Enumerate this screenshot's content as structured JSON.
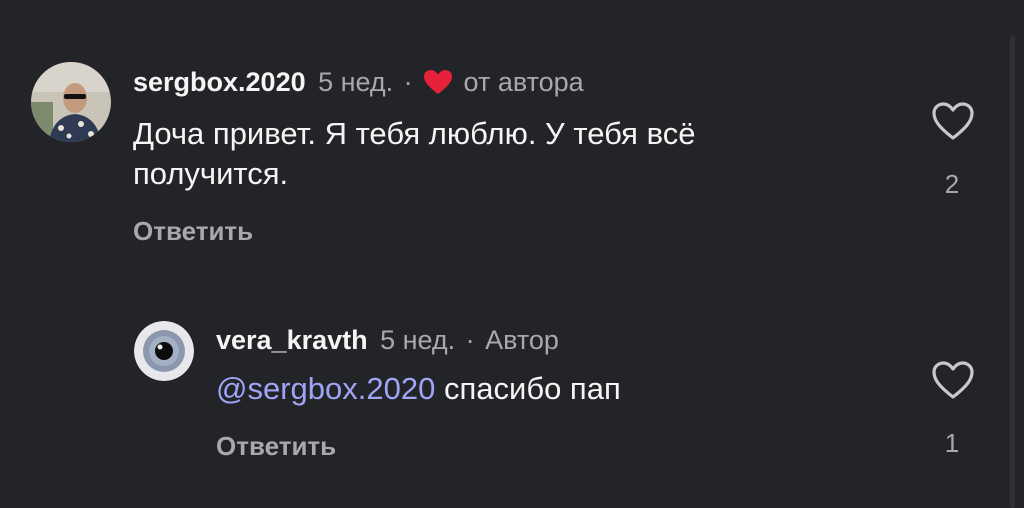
{
  "comments": [
    {
      "username": "sergbox.2020",
      "time": "5 нед.",
      "separator": "·",
      "badge": "от автора",
      "badge_icon": "heart-icon",
      "text": "Доча привет. Я тебя люблю. У тебя всё получится.",
      "reply_label": "Ответить",
      "likes": "2"
    },
    {
      "username": "vera_kravth",
      "time": "5 нед.",
      "separator": "·",
      "badge": "Автор",
      "mention": "@sergbox.2020",
      "text": "спасибо пап",
      "reply_label": "Ответить",
      "likes": "1"
    }
  ],
  "colors": {
    "background": "#232427",
    "mention": "#9fa4f5",
    "heart": "#e8213a",
    "muted": "#a8a8ad"
  }
}
